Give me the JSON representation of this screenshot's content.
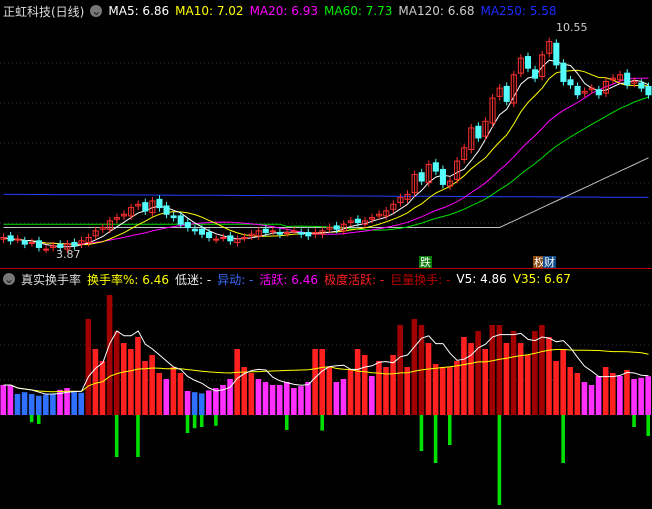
{
  "price_header": {
    "title": "正虹科技(日线)",
    "ma5": "MA5: 6.86",
    "ma10": "MA10: 7.02",
    "ma20": "MA20: 6.93",
    "ma60": "MA60: 7.73",
    "ma120": "MA120: 6.68",
    "ma250": "MA250: 5.58"
  },
  "ind_header": {
    "title": "真实换手率",
    "rate": "换手率%: 6.46",
    "low": "低迷: -",
    "abn": "异动: -",
    "active": "活跃: 6.46",
    "very": "极度活跃: -",
    "huge": "巨量换手: -",
    "v5": "V5: 4.86",
    "v35": "V35: 6.67"
  },
  "annotations": {
    "high": "10.55",
    "low": "3.87",
    "badge1": "跌",
    "badge2": "权",
    "badge3": "财"
  },
  "colors": {
    "up": "#ff3030",
    "down": "#54fcfc",
    "ma5": "#ffffff",
    "ma10": "#ffff00",
    "ma20": "#ff00ff",
    "ma60": "#00e000",
    "ma120": "#c0c0c0",
    "ma250": "#2040ff"
  },
  "chart_data": {
    "type": "candlestick",
    "closes": [
      4.3,
      4.2,
      4.25,
      4.1,
      4.15,
      4.0,
      3.95,
      4.05,
      4.0,
      4.1,
      4.05,
      4.2,
      4.3,
      4.5,
      4.6,
      4.8,
      4.9,
      5.0,
      5.2,
      5.3,
      5.1,
      5.4,
      5.2,
      5.0,
      4.9,
      4.7,
      4.6,
      4.5,
      4.4,
      4.3,
      4.25,
      4.3,
      4.2,
      4.25,
      4.3,
      4.4,
      4.5,
      4.45,
      4.5,
      4.4,
      4.45,
      4.5,
      4.4,
      4.35,
      4.45,
      4.5,
      4.6,
      4.55,
      4.7,
      4.8,
      4.75,
      4.8,
      4.9,
      5.0,
      5.1,
      5.3,
      5.5,
      5.6,
      6.2,
      6.0,
      6.5,
      6.3,
      5.9,
      6.0,
      6.6,
      7.0,
      7.6,
      7.3,
      7.8,
      8.5,
      8.8,
      8.4,
      9.2,
      9.7,
      9.4,
      9.1,
      9.8,
      10.2,
      9.5,
      9.0,
      8.9,
      8.6,
      8.7,
      8.8,
      8.6,
      9.0,
      9.1,
      9.2,
      8.9,
      9.0,
      8.8,
      8.6
    ],
    "turnover": [
      5,
      5,
      3.5,
      3.8,
      3.5,
      3.2,
      3.4,
      3.6,
      4.2,
      4.5,
      3.8,
      3.7,
      16,
      11,
      9,
      20,
      14,
      12,
      11,
      13,
      9,
      10,
      7,
      6,
      8,
      7,
      4,
      3.8,
      3.6,
      4.1,
      4.5,
      5,
      6,
      11,
      8,
      7,
      6,
      5.5,
      5,
      5,
      5.5,
      4.5,
      4.8,
      5.5,
      11,
      11,
      8,
      5.5,
      6,
      7.5,
      11,
      10,
      6.5,
      9,
      8,
      10,
      15,
      8,
      16,
      15,
      12,
      8.5,
      8,
      8,
      9,
      13,
      12,
      14,
      11,
      15,
      15,
      12,
      14,
      12,
      10,
      14,
      15,
      13,
      9,
      11,
      8,
      7,
      5.5,
      5,
      6.5,
      8,
      7,
      6.5,
      7.5,
      6,
      6.2,
      6.46
    ],
    "neg": [
      0,
      0,
      0,
      0,
      1.2,
      1.5,
      0,
      0,
      0,
      0,
      0,
      0,
      0,
      0,
      0,
      0,
      7,
      0,
      0,
      7,
      0,
      0,
      0,
      0,
      0,
      0,
      3,
      2.2,
      2,
      0,
      1.8,
      0,
      0,
      0,
      0,
      0,
      0,
      0,
      0,
      0,
      2.5,
      0,
      0,
      0,
      0,
      2.6,
      0,
      0,
      0,
      0,
      0,
      0,
      0,
      0,
      0,
      0,
      0,
      0,
      0,
      6,
      0,
      8,
      0,
      5,
      0,
      0,
      0,
      0,
      0,
      0,
      15,
      0,
      0,
      0,
      0,
      0,
      0,
      0,
      0,
      8,
      0,
      0,
      0,
      0,
      0,
      0,
      0,
      0,
      0,
      2,
      0,
      3.5
    ]
  }
}
